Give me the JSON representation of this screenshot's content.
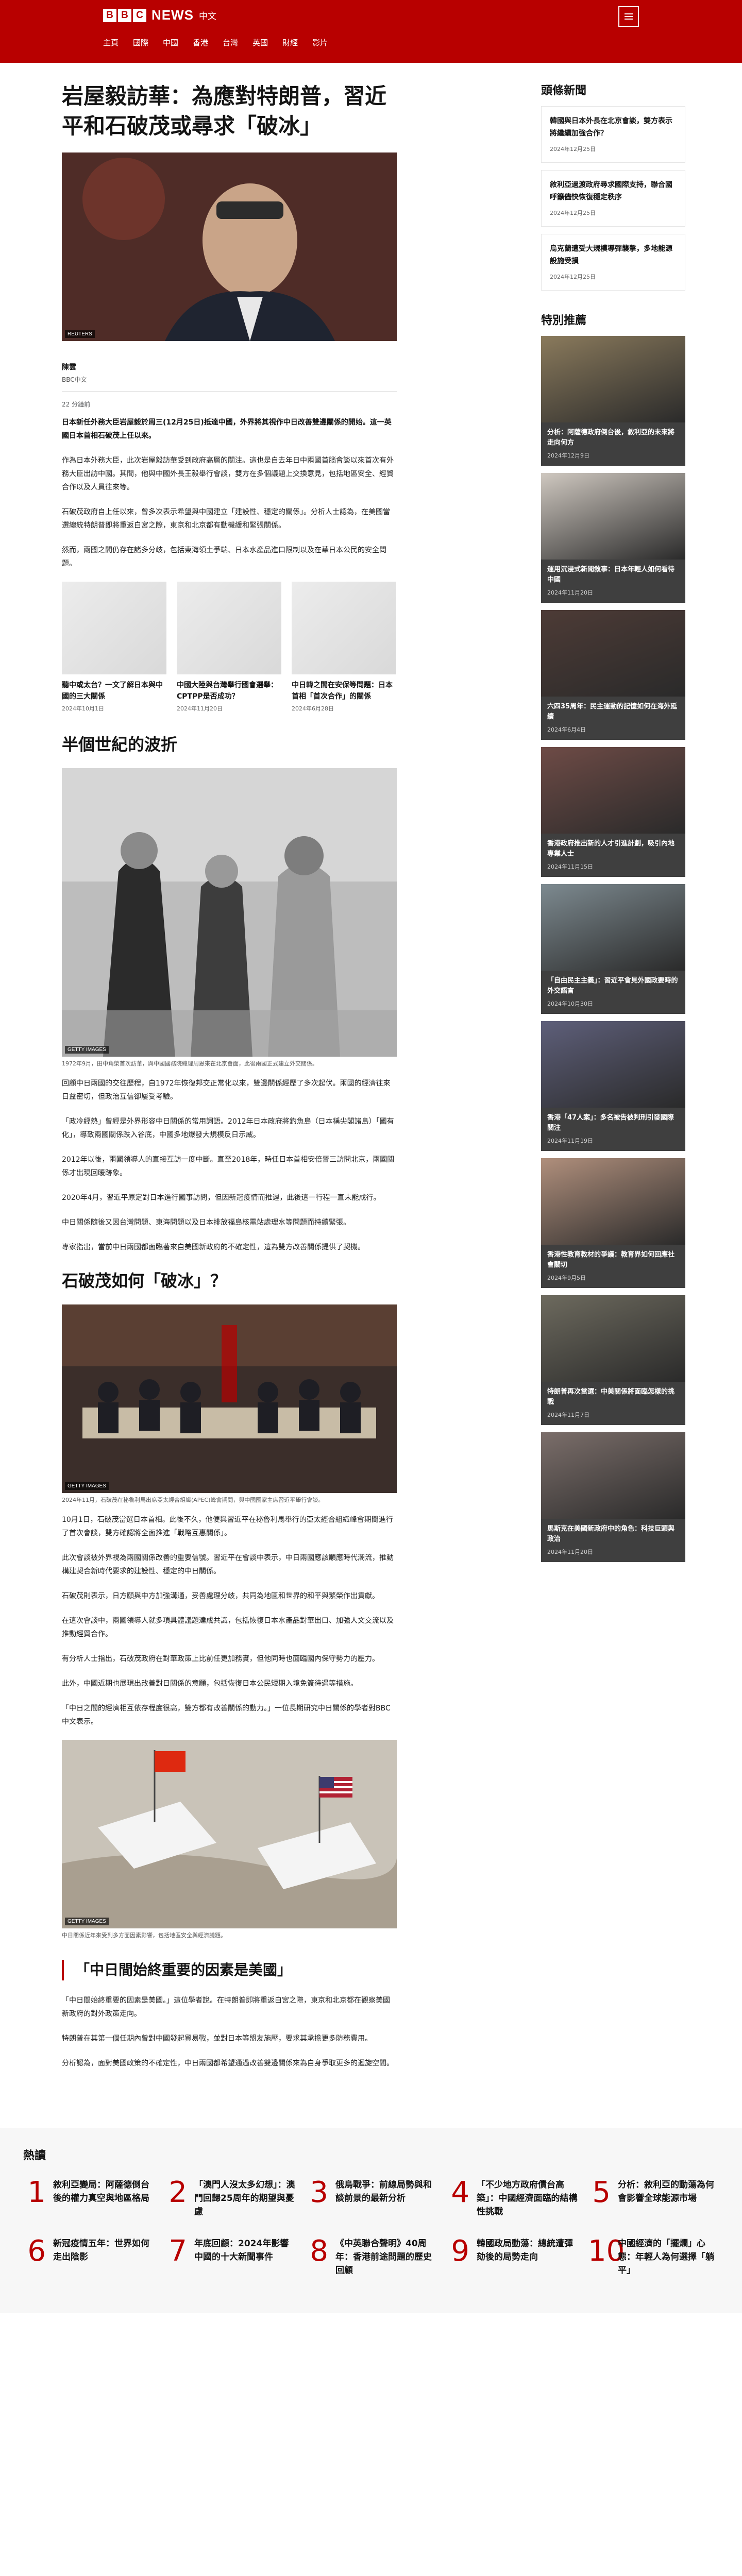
{
  "site": {
    "brand_letters": [
      "B",
      "B",
      "C"
    ],
    "brand_word": "NEWS",
    "lang": "中文"
  },
  "nav": [
    "主頁",
    "國際",
    "中國",
    "香港",
    "台灣",
    "英國",
    "財經",
    "影片"
  ],
  "article": {
    "headline": "岩屋毅訪華：為應對特朗普，習近平和石破茂或尋求「破冰」",
    "hero_credit": "REUTERS",
    "author": "陳雲",
    "author_role": "BBC中文",
    "date": "22 分鐘前",
    "lead": "日本新任外務大臣岩屋毅於周三(12月25日)抵達中國，外界將其視作中日改善雙邊關係的開始。這一英國日本首相石破茂上任以來。",
    "paras_1": [
      "作為日本外務大臣，此次岩屋毅訪華受到政府高層的關注。這也是自去年日中兩國首腦會談以來首次有外務大臣出訪中國。其間，他與中國外長王毅舉行會談，雙方在多個議題上交換意見，包括地區安全、經貿合作以及人員往來等。",
      "石破茂政府自上任以來，曾多次表示希望與中國建立「建設性、穩定的關係」。分析人士認為，在美國當選總統特朗普即將重返白宮之際，東京和北京都有動機緩和緊張關係。",
      "然而，兩國之間仍存在諸多分歧，包括東海領土爭端、日本水產品進口限制以及在華日本公民的安全問題。"
    ],
    "related": [
      {
        "title": "聽中或太台？一文了解日本與中國的三大關係",
        "date": "2024年10月1日"
      },
      {
        "title": "中國大陸與台灣舉行國會選舉：CPTPP是否成功？",
        "date": "2024年11月20日"
      },
      {
        "title": "中日韓之間在安保等問題：日本首相「首次合作」的關係",
        "date": "2024年6月28日"
      }
    ],
    "section_1": "半個世紀的波折",
    "photo2_credit": "GETTY IMAGES",
    "photo2_caption": "1972年9月，田中角榮首次訪華，與中國國務院總理周恩來在北京會面，此後兩國正式建立外交關係。",
    "paras_2": [
      "回顧中日兩國的交往歷程，自1972年恢復邦交正常化以來，雙邊關係經歷了多次起伏。兩國的經濟往來日益密切，但政治互信卻屢受考驗。",
      "「政冷經熱」曾經是外界形容中日關係的常用詞語。2012年日本政府將釣魚島（日本稱尖閣諸島）「國有化」，導致兩國關係跌入谷底，中國多地爆發大規模反日示威。",
      "2012年以後，兩國領導人的直接互訪一度中斷。直至2018年，時任日本首相安倍晉三訪問北京，兩國關係才出現回暖跡象。",
      "2020年4月，習近平原定對日本進行國事訪問，但因新冠疫情而推遲，此後這一行程一直未能成行。",
      "中日關係隨後又因台灣問題、東海問題以及日本排放福島核電站處理水等問題而持續緊張。",
      "專家指出，當前中日兩國都面臨著來自美國新政府的不確定性，這為雙方改善關係提供了契機。"
    ],
    "section_2": "石破茂如何「破冰」？",
    "photo3_credit": "GETTY IMAGES",
    "photo3_caption": "2024年11月，石破茂在秘魯利馬出席亞太經合組織(APEC)峰會期間，與中國國家主席習近平舉行會談。",
    "paras_3": [
      "10月1日，石破茂當選日本首相。此後不久，他便與習近平在秘魯利馬舉行的亞太經合組織峰會期間進行了首次會談，雙方確認將全面推進「戰略互惠關係」。",
      "此次會談被外界視為兩國關係改善的重要信號。習近平在會談中表示，中日兩國應該順應時代潮流，推動構建契合新時代要求的建設性、穩定的中日關係。",
      "石破茂則表示，日方願與中方加強溝通，妥善處理分歧，共同為地區和世界的和平與繁榮作出貢獻。",
      "在這次會談中，兩國領導人就多項具體議題達成共識，包括恢復日本水產品對華出口、加強人文交流以及推動經貿合作。",
      "有分析人士指出，石破茂政府在對華政策上比前任更加務實，但他同時也面臨國內保守勢力的壓力。",
      "此外，中國近期也展現出改善對日關係的意願，包括恢復日本公民短期入境免簽待遇等措施。",
      "「中日之間的經濟相互依存程度很高，雙方都有改善關係的動力。」一位長期研究中日關係的學者對BBC中文表示。"
    ],
    "photo4_credit": "GETTY IMAGES",
    "photo4_caption": "中日關係近年來受到多方面因素影響，包括地區安全與經濟議題。",
    "pull_quote": "「中日間始終重要的因素是美國」",
    "paras_4": [
      "「中日間始終重要的因素是美國。」這位學者說。在特朗普即將重返白宮之際，東京和北京都在觀察美國新政府的對外政策走向。",
      "特朗普在其第一個任期內曾對中國發起貿易戰，並對日本等盟友施壓，要求其承擔更多防務費用。",
      "分析認為，面對美國政策的不確定性，中日兩國都希望通過改善雙邊關係來為自身爭取更多的迴旋空間。"
    ]
  },
  "sidebar": {
    "latest_heading": "頭條新聞",
    "latest": [
      {
        "title": "韓國與日本外長在北京會談，雙方表示將繼續加強合作？",
        "date": "2024年12月25日"
      },
      {
        "title": "敘利亞過渡政府尋求國際支持，聯合國呼籲儘快恢復穩定秩序",
        "date": "2024年12月25日"
      },
      {
        "title": "烏克蘭遭受大規模導彈襲擊，多地能源設施受損",
        "date": "2024年12月25日"
      }
    ],
    "featured_heading": "特別推薦",
    "featured": [
      {
        "title": "分析：阿薩德政府倒台後，敘利亞的未來將走向何方",
        "date": "2024年12月9日",
        "color": "#8a7a5c"
      },
      {
        "title": "運用沉浸式新聞敘事：日本年輕人如何看待中國",
        "date": "2024年11月20日",
        "color": "#cfc8c0"
      },
      {
        "title": "六四35周年：民主運動的記憶如何在海外延續",
        "date": "2024年6月4日",
        "color": "#4d3b36"
      },
      {
        "title": "香港政府推出新的人才引進計劃，吸引內地專業人士",
        "date": "2024年11月15日",
        "color": "#6e4b46"
      },
      {
        "title": "「自由民主主義」：習近平會見外國政要時的外交語言",
        "date": "2024年10月30日",
        "color": "#7d8a90"
      },
      {
        "title": "香港「47人案」：多名被告被判刑引發國際關注",
        "date": "2024年11月19日",
        "color": "#5e5f7a"
      },
      {
        "title": "香港性教育教材的爭議：教育界如何回應社會關切",
        "date": "2024年9月5日",
        "color": "#b08f7c"
      },
      {
        "title": "特朗普再次當選：中美關係將面臨怎樣的挑戰",
        "date": "2024年11月7日",
        "color": "#6d6a5e"
      },
      {
        "title": "馬斯克在美國新政府中的角色：科技巨頭與政治",
        "date": "2024年11月20日",
        "color": "#7b6e6a"
      }
    ]
  },
  "most_read": {
    "heading": "熱讀",
    "items": [
      {
        "num": "1",
        "title": "敘利亞變局：阿薩德倒台後的權力真空與地區格局"
      },
      {
        "num": "2",
        "title": "「澳門人沒太多幻想」：澳門回歸25周年的期望與憂慮"
      },
      {
        "num": "3",
        "title": "俄烏戰爭：前線局勢與和談前景的最新分析"
      },
      {
        "num": "4",
        "title": "「不少地方政府債台高築」：中國經濟面臨的結構性挑戰"
      },
      {
        "num": "5",
        "title": "分析：敘利亞的動蕩為何會影響全球能源市場"
      },
      {
        "num": "6",
        "title": "新冠疫情五年：世界如何走出陰影"
      },
      {
        "num": "7",
        "title": "年底回顧：2024年影響中國的十大新聞事件"
      },
      {
        "num": "8",
        "title": "《中英聯合聲明》40周年：香港前途問題的歷史回顧"
      },
      {
        "num": "9",
        "title": "韓國政局動蕩：總統遭彈劾後的局勢走向"
      },
      {
        "num": "10",
        "title": "中國經濟的「擺爛」心態：年輕人為何選擇「躺平」"
      }
    ]
  }
}
